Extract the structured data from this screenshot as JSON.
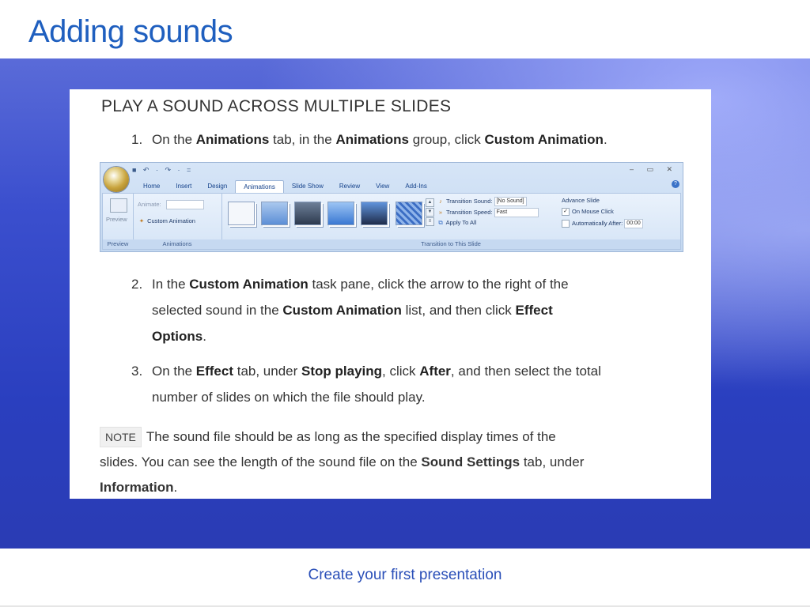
{
  "slide": {
    "title": "Adding sounds",
    "footer": "Create your first presentation"
  },
  "content": {
    "heading": "PLAY A SOUND ACROSS MULTIPLE SLIDES",
    "steps": [
      {
        "num": "1.",
        "parts": [
          "On the ",
          "Animations",
          " tab, in the ",
          "Animations",
          " group, click ",
          "Custom Animation",
          "."
        ]
      },
      {
        "num": "2.",
        "line1": [
          "In the ",
          "Custom Animation",
          " task pane, click the arrow to the right of the"
        ],
        "line2": [
          "selected sound in the ",
          "Custom Animation",
          " list, and then click ",
          "Effect"
        ],
        "line3": [
          "Options",
          "."
        ]
      },
      {
        "num": "3.",
        "line1": [
          "On the ",
          "Effect",
          " tab, under ",
          "Stop playing",
          ", click ",
          "After",
          ", and then select the total"
        ],
        "line2": "number of slides on which the file should play."
      }
    ],
    "note": {
      "badge": "NOTE",
      "line1": "The sound file should be as long as the specified display times of the",
      "line2": [
        "slides. You can see the length of the sound file on the ",
        "Sound Settings",
        " tab, under"
      ],
      "line3": [
        "Information",
        "."
      ]
    }
  },
  "ribbon": {
    "quick_access": "■ ↶ · ↷ · =",
    "window_controls": "– ▭ ✕",
    "tabs": [
      "Home",
      "Insert",
      "Design",
      "Animations",
      "Slide Show",
      "Review",
      "View",
      "Add-Ins"
    ],
    "active_tab": "Animations",
    "help": "?",
    "groups": {
      "preview": {
        "button": "Preview",
        "label": "Preview"
      },
      "animations": {
        "animate_label": "Animate:",
        "custom_animation": "Custom Animation",
        "label": "Animations"
      },
      "transition": {
        "sound_label": "Transition Sound:",
        "sound_value": "[No Sound]",
        "speed_label": "Transition Speed:",
        "speed_value": "Fast",
        "apply_all": "Apply To All",
        "advance_label": "Advance Slide",
        "on_mouse_click": "On Mouse Click",
        "auto_after": "Automatically After:",
        "auto_value": "00:00",
        "label": "Transition to This Slide"
      }
    },
    "colors": {
      "accent": "#1f5fbf",
      "band": "#2a3fbf"
    }
  }
}
